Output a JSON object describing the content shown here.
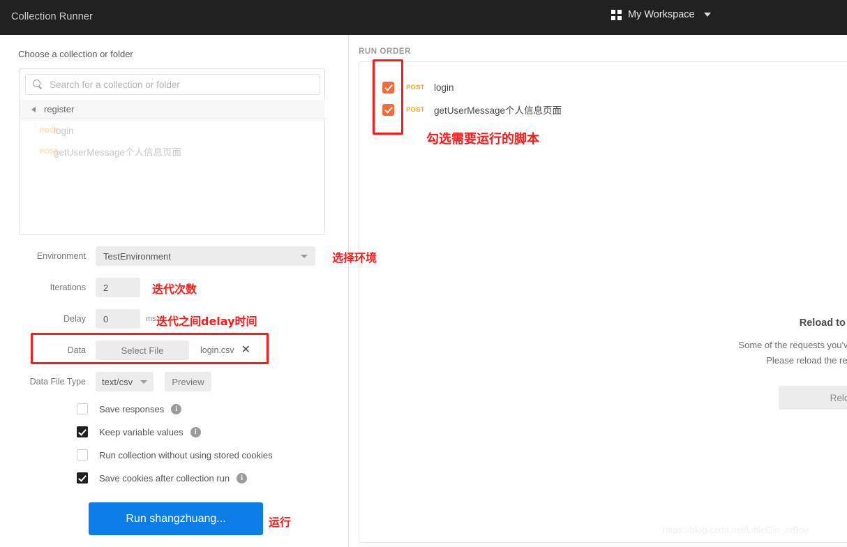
{
  "topbar": {
    "title": "Collection Runner",
    "workspace": "My Workspace",
    "workspace_icon": "grid-icon",
    "caret_icon": "chevron-down-icon"
  },
  "left": {
    "choose_label": "Choose a collection or folder",
    "search": {
      "placeholder": "Search for a collection or folder",
      "value": "",
      "icon": "search-icon"
    },
    "folder": {
      "name": "register",
      "icon": "triangle-left-icon"
    },
    "requests": [
      {
        "method": "POST",
        "name": "login"
      },
      {
        "method": "POST",
        "name": "getUserMessage个人信息页面"
      }
    ],
    "environment": {
      "label": "Environment",
      "value": "TestEnvironment",
      "caret_icon": "chevron-down-icon"
    },
    "iterations": {
      "label": "Iterations",
      "value": "2"
    },
    "delay": {
      "label": "Delay",
      "value": "0",
      "unit": "ms"
    },
    "data": {
      "label": "Data",
      "select_file_label": "Select File",
      "file_name": "login.csv",
      "clear_icon": "close-icon"
    },
    "data_file_type": {
      "label": "Data File Type",
      "value": "text/csv",
      "preview_label": "Preview",
      "caret_icon": "chevron-down-icon"
    },
    "options": [
      {
        "label": "Save responses",
        "checked": false,
        "info": true
      },
      {
        "label": "Keep variable values",
        "checked": true,
        "info": true
      },
      {
        "label": "Run collection without using stored cookies",
        "checked": false,
        "info": false
      },
      {
        "label": "Save cookies after collection run",
        "checked": true,
        "info": true
      }
    ],
    "run_button": "Run shangzhuang..."
  },
  "right": {
    "run_order_label": "RUN ORDER",
    "run_order_items": [
      {
        "checked": true,
        "method": "POST",
        "name": "login"
      },
      {
        "checked": true,
        "method": "POST",
        "name": "getUserMessage个人信息页面"
      }
    ],
    "reload_notice": {
      "title": "Reload to continue",
      "line1": "Some of the requests you've selected have changed.",
      "line2": "Please reload the requests to continue.",
      "button": "Reload"
    }
  },
  "annotations": {
    "check_scripts": "勾选需要运行的脚本",
    "select_environment": "选择环境",
    "iteration_count": "迭代次数",
    "delay_between": "迭代之间delay时间",
    "run": "运行"
  },
  "watermark": "https://blog.csdn.net/LittleGirl_orBoy",
  "colors": {
    "topbar_bg": "#212121",
    "accent_blue": "#0d7ee8",
    "method_orange": "#f5a623",
    "checkbox_orange": "#f26c38",
    "annotation_red": "#ff1a1a"
  }
}
